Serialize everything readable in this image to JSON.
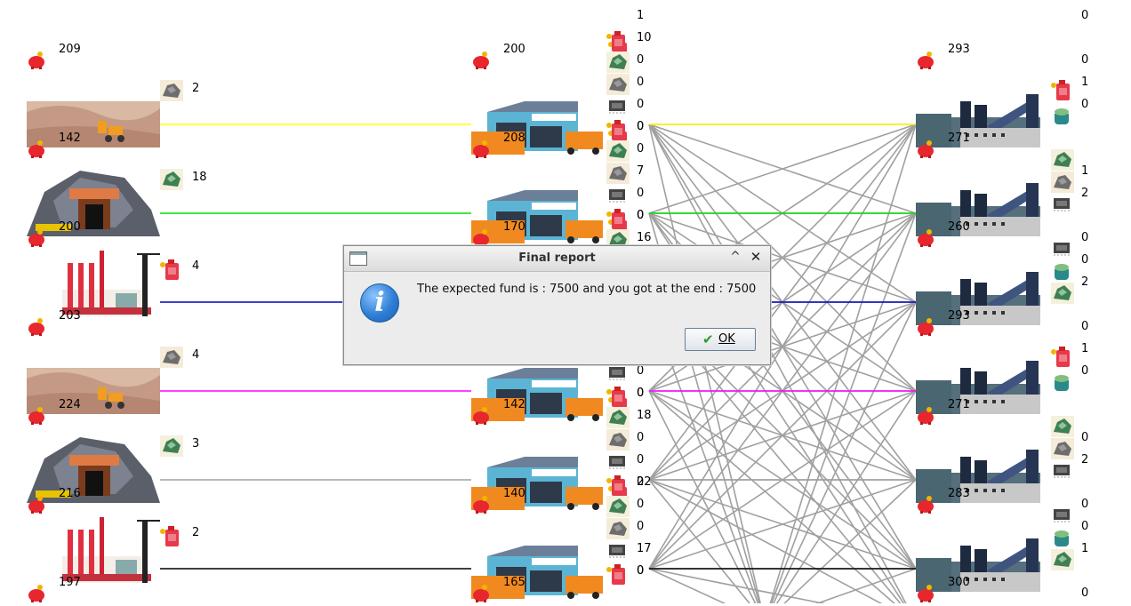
{
  "colors": {
    "line_gray": "#a0a0a0",
    "rows": [
      "#ffff00",
      "#00e000",
      "#0000c0",
      "#ff00ff",
      "#a0a0a0",
      "#000000"
    ]
  },
  "icons": {
    "piggy": "piggy-bank-icon",
    "fuel": "fuel-can-icon",
    "ore": "ore-rock-icon",
    "green_ore": "green-ore-icon",
    "chip": "chip-icon",
    "pot": "pot-icon"
  },
  "sources": [
    {
      "type": "quarry",
      "fund": "209",
      "stock": "142",
      "resource": "ore",
      "qty": "2"
    },
    {
      "type": "mine",
      "fund": "",
      "stock": "200",
      "resource": "green_ore",
      "qty": "18"
    },
    {
      "type": "factory",
      "fund": "",
      "stock": "203",
      "resource": "fuel",
      "qty": "4"
    },
    {
      "type": "quarry",
      "fund": "",
      "stock": "224",
      "resource": "ore",
      "qty": "4"
    },
    {
      "type": "mine",
      "fund": "",
      "stock": "216",
      "resource": "green_ore",
      "qty": "3"
    },
    {
      "type": "factory",
      "fund": "",
      "stock": "197",
      "resource": "fuel",
      "qty": "2"
    }
  ],
  "warehouses": {
    "top_fund": "200",
    "stocks": [
      "208",
      "170",
      "",
      "142",
      "140",
      "165"
    ],
    "column_numbers": [
      "1",
      "10",
      "0",
      "0",
      "0",
      "0",
      "0",
      "7",
      "0",
      "0",
      "16",
      "",
      "",
      "",
      "",
      "0",
      "0",
      "0",
      "18",
      "0",
      "0",
      "22",
      "0",
      "0",
      "17",
      "0"
    ],
    "overlay_numbers": [
      "0",
      "0",
      "0",
      "0",
      "0",
      "0"
    ]
  },
  "factories": {
    "top_fund": "293",
    "stocks": [
      "271",
      "260",
      "293",
      "271",
      "283",
      "300"
    ],
    "column_numbers": [
      "0",
      "0",
      "1",
      "0",
      "1",
      "2",
      "0",
      "0",
      "2",
      "0",
      "1",
      "0",
      "0",
      "2",
      "0",
      "0",
      "1",
      "0"
    ]
  },
  "dialog": {
    "title": "Final report",
    "message": "The expected fund is : 7500 and you got at the end : 7500",
    "ok_label": "OK",
    "collapse_glyph": "^",
    "close_glyph": "✕",
    "info_glyph": "i"
  }
}
